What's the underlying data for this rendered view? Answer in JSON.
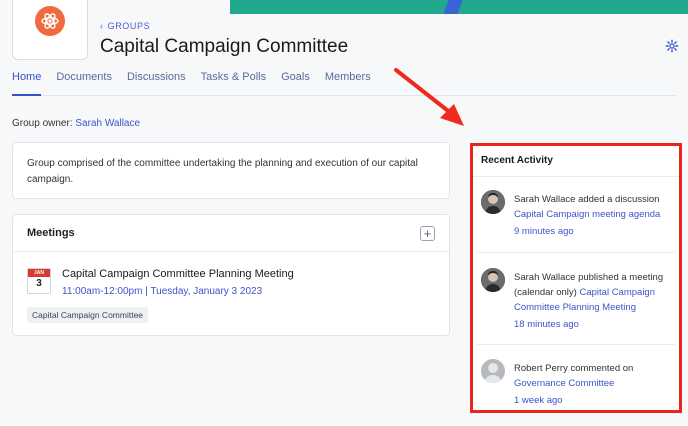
{
  "header": {
    "breadcrumb": "GROUPS",
    "title": "Capital Campaign Committee"
  },
  "tabs": [
    {
      "label": "Home",
      "active": true
    },
    {
      "label": "Documents",
      "active": false
    },
    {
      "label": "Discussions",
      "active": false
    },
    {
      "label": "Tasks & Polls",
      "active": false
    },
    {
      "label": "Goals",
      "active": false
    },
    {
      "label": "Members",
      "active": false
    }
  ],
  "owner": {
    "label": "Group owner:",
    "name": "Sarah Wallace"
  },
  "description": "Group comprised of the committee undertaking the planning and execution of our capital campaign.",
  "meetings": {
    "title": "Meetings",
    "add_label": "+",
    "items": [
      {
        "calendar_month": "JAN",
        "calendar_day": "3",
        "name": "Capital Campaign Committee Planning Meeting",
        "time": "11:00am-12:00pm | Tuesday, January 3 2023",
        "tag": "Capital Campaign Committee"
      }
    ]
  },
  "activity": {
    "title": "Recent Activity",
    "items": [
      {
        "text": "Sarah Wallace added a discussion",
        "link": "Capital Campaign meeting agenda",
        "time": "9 minutes ago"
      },
      {
        "text": "Sarah Wallace published a meeting (calendar only)",
        "link": "Capital Campaign Committee Planning Meeting",
        "time": "18 minutes ago"
      },
      {
        "text": "Robert Perry commented on",
        "link": "Governance Committee",
        "time": "1 week ago"
      }
    ]
  },
  "colors": {
    "accent": "#3550c8",
    "highlight": "#e9261a",
    "banner": "#1fa88c",
    "logo": "#f06a3f"
  },
  "icons": [
    "atom-icon",
    "chevron-left-icon",
    "gear-icon",
    "plus-icon",
    "calendar-icon",
    "arrow-annotation"
  ]
}
